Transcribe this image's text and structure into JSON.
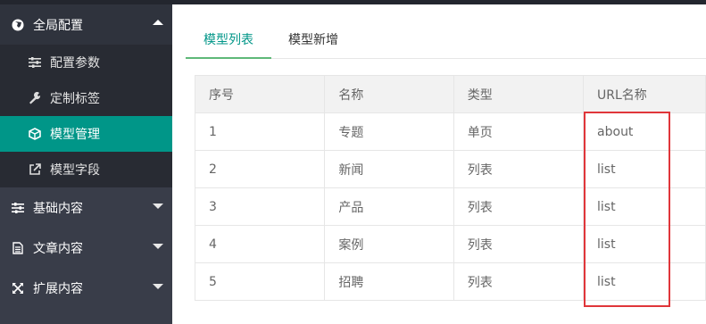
{
  "sidebar": {
    "groups": [
      {
        "label": "全局配置",
        "icon": "globe-icon",
        "expanded": true,
        "items": [
          {
            "label": "配置参数",
            "icon": "sliders-icon"
          },
          {
            "label": "定制标签",
            "icon": "wrench-icon"
          },
          {
            "label": "模型管理",
            "icon": "cube-icon",
            "active": true
          },
          {
            "label": "模型字段",
            "icon": "external-link-icon"
          }
        ]
      },
      {
        "label": "基础内容",
        "icon": "sliders-icon"
      },
      {
        "label": "文章内容",
        "icon": "file-icon"
      },
      {
        "label": "扩展内容",
        "icon": "expand-icon"
      }
    ]
  },
  "tabs": [
    {
      "label": "模型列表",
      "active": true
    },
    {
      "label": "模型新增"
    }
  ],
  "table": {
    "headers": [
      "序号",
      "名称",
      "类型",
      "URL名称"
    ],
    "rows": [
      [
        "1",
        "专题",
        "单页",
        "about"
      ],
      [
        "2",
        "新闻",
        "列表",
        "list"
      ],
      [
        "3",
        "产品",
        "列表",
        "list"
      ],
      [
        "4",
        "案例",
        "列表",
        "list"
      ],
      [
        "5",
        "招聘",
        "列表",
        "list"
      ]
    ]
  },
  "colors": {
    "accent": "#009688",
    "sidebar": "#393d49",
    "highlight_box": "#e0363a"
  }
}
